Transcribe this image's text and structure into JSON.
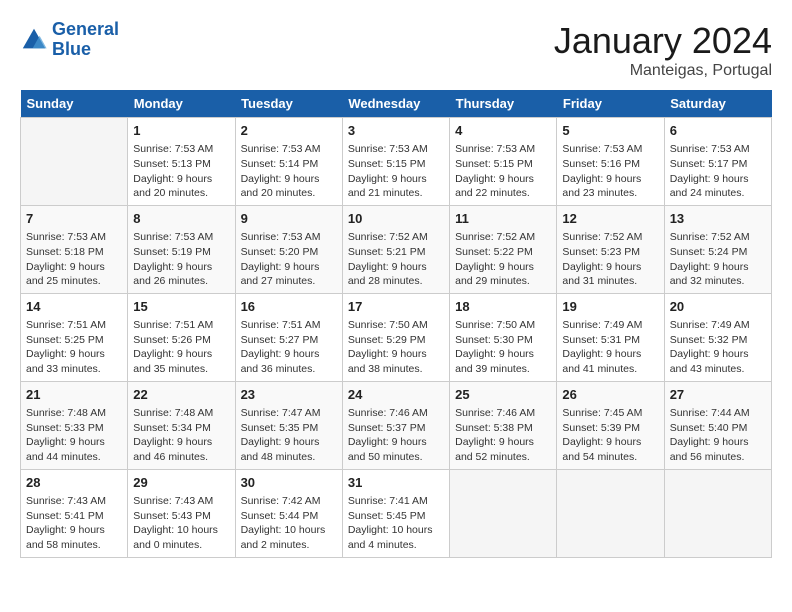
{
  "header": {
    "logo_line1": "General",
    "logo_line2": "Blue",
    "month": "January 2024",
    "location": "Manteigas, Portugal"
  },
  "weekdays": [
    "Sunday",
    "Monday",
    "Tuesday",
    "Wednesday",
    "Thursday",
    "Friday",
    "Saturday"
  ],
  "weeks": [
    [
      {
        "day": "",
        "info": ""
      },
      {
        "day": "1",
        "info": "Sunrise: 7:53 AM\nSunset: 5:13 PM\nDaylight: 9 hours\nand 20 minutes."
      },
      {
        "day": "2",
        "info": "Sunrise: 7:53 AM\nSunset: 5:14 PM\nDaylight: 9 hours\nand 20 minutes."
      },
      {
        "day": "3",
        "info": "Sunrise: 7:53 AM\nSunset: 5:15 PM\nDaylight: 9 hours\nand 21 minutes."
      },
      {
        "day": "4",
        "info": "Sunrise: 7:53 AM\nSunset: 5:15 PM\nDaylight: 9 hours\nand 22 minutes."
      },
      {
        "day": "5",
        "info": "Sunrise: 7:53 AM\nSunset: 5:16 PM\nDaylight: 9 hours\nand 23 minutes."
      },
      {
        "day": "6",
        "info": "Sunrise: 7:53 AM\nSunset: 5:17 PM\nDaylight: 9 hours\nand 24 minutes."
      }
    ],
    [
      {
        "day": "7",
        "info": "Sunrise: 7:53 AM\nSunset: 5:18 PM\nDaylight: 9 hours\nand 25 minutes."
      },
      {
        "day": "8",
        "info": "Sunrise: 7:53 AM\nSunset: 5:19 PM\nDaylight: 9 hours\nand 26 minutes."
      },
      {
        "day": "9",
        "info": "Sunrise: 7:53 AM\nSunset: 5:20 PM\nDaylight: 9 hours\nand 27 minutes."
      },
      {
        "day": "10",
        "info": "Sunrise: 7:52 AM\nSunset: 5:21 PM\nDaylight: 9 hours\nand 28 minutes."
      },
      {
        "day": "11",
        "info": "Sunrise: 7:52 AM\nSunset: 5:22 PM\nDaylight: 9 hours\nand 29 minutes."
      },
      {
        "day": "12",
        "info": "Sunrise: 7:52 AM\nSunset: 5:23 PM\nDaylight: 9 hours\nand 31 minutes."
      },
      {
        "day": "13",
        "info": "Sunrise: 7:52 AM\nSunset: 5:24 PM\nDaylight: 9 hours\nand 32 minutes."
      }
    ],
    [
      {
        "day": "14",
        "info": "Sunrise: 7:51 AM\nSunset: 5:25 PM\nDaylight: 9 hours\nand 33 minutes."
      },
      {
        "day": "15",
        "info": "Sunrise: 7:51 AM\nSunset: 5:26 PM\nDaylight: 9 hours\nand 35 minutes."
      },
      {
        "day": "16",
        "info": "Sunrise: 7:51 AM\nSunset: 5:27 PM\nDaylight: 9 hours\nand 36 minutes."
      },
      {
        "day": "17",
        "info": "Sunrise: 7:50 AM\nSunset: 5:29 PM\nDaylight: 9 hours\nand 38 minutes."
      },
      {
        "day": "18",
        "info": "Sunrise: 7:50 AM\nSunset: 5:30 PM\nDaylight: 9 hours\nand 39 minutes."
      },
      {
        "day": "19",
        "info": "Sunrise: 7:49 AM\nSunset: 5:31 PM\nDaylight: 9 hours\nand 41 minutes."
      },
      {
        "day": "20",
        "info": "Sunrise: 7:49 AM\nSunset: 5:32 PM\nDaylight: 9 hours\nand 43 minutes."
      }
    ],
    [
      {
        "day": "21",
        "info": "Sunrise: 7:48 AM\nSunset: 5:33 PM\nDaylight: 9 hours\nand 44 minutes."
      },
      {
        "day": "22",
        "info": "Sunrise: 7:48 AM\nSunset: 5:34 PM\nDaylight: 9 hours\nand 46 minutes."
      },
      {
        "day": "23",
        "info": "Sunrise: 7:47 AM\nSunset: 5:35 PM\nDaylight: 9 hours\nand 48 minutes."
      },
      {
        "day": "24",
        "info": "Sunrise: 7:46 AM\nSunset: 5:37 PM\nDaylight: 9 hours\nand 50 minutes."
      },
      {
        "day": "25",
        "info": "Sunrise: 7:46 AM\nSunset: 5:38 PM\nDaylight: 9 hours\nand 52 minutes."
      },
      {
        "day": "26",
        "info": "Sunrise: 7:45 AM\nSunset: 5:39 PM\nDaylight: 9 hours\nand 54 minutes."
      },
      {
        "day": "27",
        "info": "Sunrise: 7:44 AM\nSunset: 5:40 PM\nDaylight: 9 hours\nand 56 minutes."
      }
    ],
    [
      {
        "day": "28",
        "info": "Sunrise: 7:43 AM\nSunset: 5:41 PM\nDaylight: 9 hours\nand 58 minutes."
      },
      {
        "day": "29",
        "info": "Sunrise: 7:43 AM\nSunset: 5:43 PM\nDaylight: 10 hours\nand 0 minutes."
      },
      {
        "day": "30",
        "info": "Sunrise: 7:42 AM\nSunset: 5:44 PM\nDaylight: 10 hours\nand 2 minutes."
      },
      {
        "day": "31",
        "info": "Sunrise: 7:41 AM\nSunset: 5:45 PM\nDaylight: 10 hours\nand 4 minutes."
      },
      {
        "day": "",
        "info": ""
      },
      {
        "day": "",
        "info": ""
      },
      {
        "day": "",
        "info": ""
      }
    ]
  ]
}
